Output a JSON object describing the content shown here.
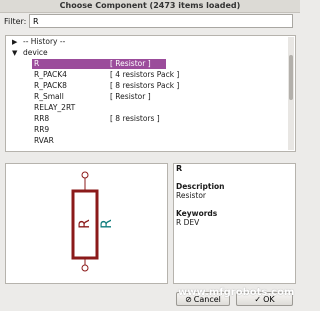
{
  "window": {
    "title": "Choose Component (2473 items loaded)"
  },
  "filter": {
    "label": "Filter:",
    "value": "R"
  },
  "tree": {
    "history": {
      "arrow": "▶",
      "label": "-- History --"
    },
    "library": {
      "arrow": "▼",
      "label": "device"
    },
    "items": [
      {
        "name": "R",
        "desc": "[ Resistor ]"
      },
      {
        "name": "R_PACK4",
        "desc": "[ 4 resistors Pack ]"
      },
      {
        "name": "R_PACK8",
        "desc": "[ 8 resistors Pack ]"
      },
      {
        "name": "R_Small",
        "desc": "[ Resistor ]"
      },
      {
        "name": "RELAY_2RT",
        "desc": ""
      },
      {
        "name": "RR8",
        "desc": "[ 8 resistors ]"
      },
      {
        "name": "RR9",
        "desc": ""
      },
      {
        "name": "RVAR",
        "desc": ""
      }
    ]
  },
  "preview": {
    "symbol_letter": "R"
  },
  "info": {
    "name": "R",
    "description_label": "Description",
    "description_value": "Resistor",
    "keywords_label": "Keywords",
    "keywords_value": "R DEV"
  },
  "buttons": {
    "cancel": "Cancel",
    "ok": "OK"
  },
  "watermark": "www.mfgrobots.com",
  "colors": {
    "selection": "#9b4c9b",
    "symbol_body": "#8b1a1a",
    "symbol_text": "#0e7c7c"
  }
}
